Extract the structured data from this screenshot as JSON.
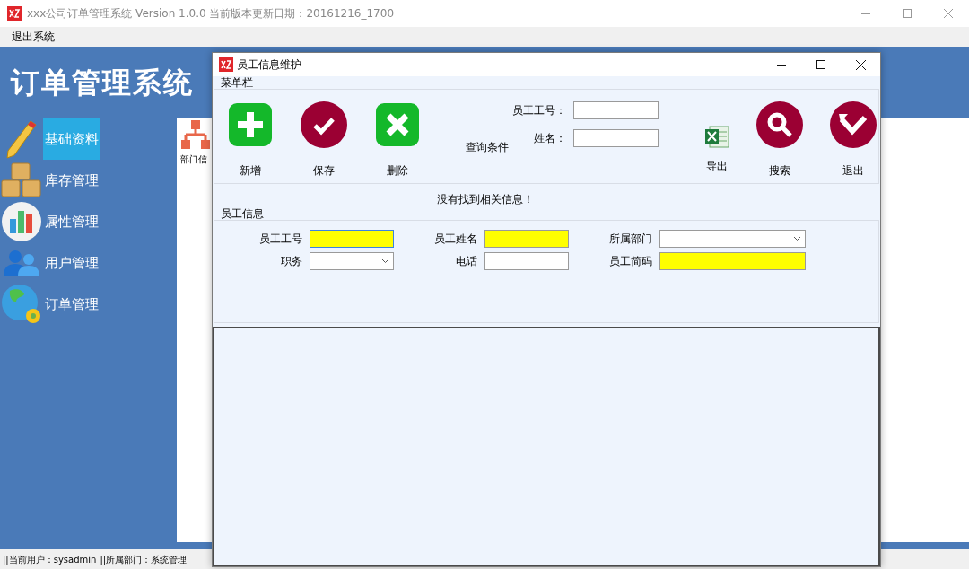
{
  "window": {
    "title": "xxx公司订单管理系统 Version 1.0.0 当前版本更新日期：20161216_1700"
  },
  "menu_bar": [
    "退出系统"
  ],
  "app_title": "订单管理系统",
  "sidebar": {
    "items": [
      {
        "label": "基础资料",
        "kind": "pencil",
        "selected": true
      },
      {
        "label": "库存管理",
        "kind": "boxes",
        "selected": false
      },
      {
        "label": "属性管理",
        "kind": "chart",
        "selected": false
      },
      {
        "label": "用户管理",
        "kind": "users",
        "selected": false
      },
      {
        "label": "订单管理",
        "kind": "globe",
        "selected": false
      }
    ]
  },
  "content": {
    "items": [
      {
        "label": "部门信"
      }
    ]
  },
  "status_bar": [
    "||当前用户：sysadmin",
    "||所属部门：系统管理"
  ],
  "dialog": {
    "title": "员工信息维护",
    "toolbar": {
      "title": "菜单栏",
      "buttons": [
        {
          "label": "新增",
          "kind": "add"
        },
        {
          "label": "保存",
          "kind": "save"
        },
        {
          "label": "删除",
          "kind": "delete"
        }
      ],
      "query": {
        "label": "查询条件",
        "fields": [
          {
            "label": "员工工号："
          },
          {
            "label": "姓名："
          }
        ]
      },
      "actions": [
        {
          "label": "导出",
          "kind": "export"
        },
        {
          "label": "搜索",
          "kind": "search"
        },
        {
          "label": "退出",
          "kind": "exit"
        }
      ]
    },
    "message": "没有找到相关信息！",
    "form": {
      "title": "员工信息",
      "fields": [
        {
          "label": "员工工号",
          "kind": "text",
          "required": true,
          "focused": true
        },
        {
          "label": "员工姓名",
          "kind": "text",
          "required": true,
          "focused": false
        },
        {
          "label": "所属部门",
          "kind": "select",
          "required": false,
          "focused": false
        },
        {
          "label": "职务",
          "kind": "select",
          "required": false,
          "focused": false
        },
        {
          "label": "电话",
          "kind": "text",
          "required": false,
          "focused": false
        },
        {
          "label": "员工简码",
          "kind": "text",
          "required": true,
          "focused": false
        }
      ]
    }
  }
}
